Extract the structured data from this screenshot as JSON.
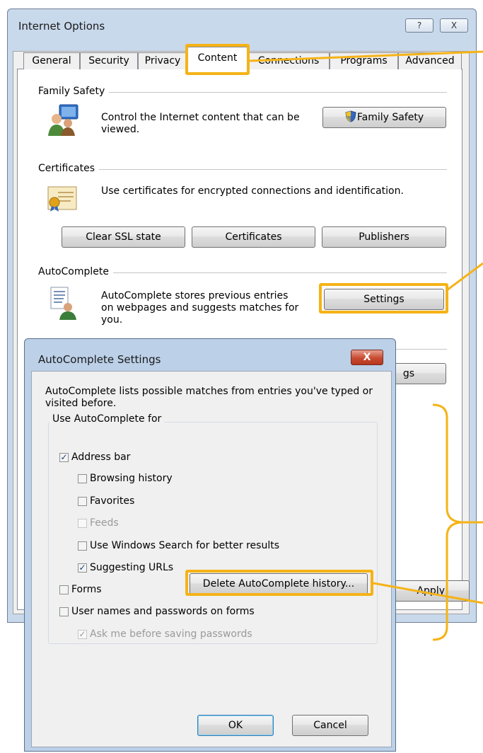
{
  "internet_options": {
    "title": "Internet Options",
    "help_button": "?",
    "close_button": "X",
    "tabs": [
      "General",
      "Security",
      "Privacy",
      "Content",
      "Connections",
      "Programs",
      "Advanced"
    ],
    "family_safety": {
      "group_label": "Family Safety",
      "description": "Control the Internet content that can be viewed.",
      "button": "Family Safety"
    },
    "certificates": {
      "group_label": "Certificates",
      "description": "Use certificates for encrypted connections and identification.",
      "buttons": [
        "Clear SSL state",
        "Certificates",
        "Publishers"
      ]
    },
    "autocomplete": {
      "group_label": "AutoComplete",
      "description": "AutoComplete stores previous entries on webpages and suggests matches for you.",
      "button": "Settings"
    },
    "hidden_button_fragment": "gs",
    "apply_button": "Apply"
  },
  "autocomplete_dialog": {
    "title": "AutoComplete Settings",
    "close_button": "X",
    "intro": "AutoComplete lists possible matches from entries you've typed or visited before.",
    "group_label": "Use AutoComplete for",
    "options": [
      {
        "label": "Address bar",
        "checked": true,
        "disabled": false
      },
      {
        "label": "Browsing history",
        "checked": false,
        "disabled": false
      },
      {
        "label": "Favorites",
        "checked": false,
        "disabled": false
      },
      {
        "label": "Feeds",
        "checked": false,
        "disabled": true
      },
      {
        "label": "Use Windows Search for better results",
        "checked": false,
        "disabled": false
      },
      {
        "label": "Suggesting URLs",
        "checked": true,
        "disabled": false
      },
      {
        "label": "Forms",
        "checked": false,
        "disabled": false
      },
      {
        "label": "User names and passwords on forms",
        "checked": false,
        "disabled": false
      },
      {
        "label": "Ask me before saving passwords",
        "checked": true,
        "disabled": true
      }
    ],
    "delete_button": "Delete AutoComplete history...",
    "ok_button": "OK",
    "cancel_button": "Cancel"
  },
  "colors": {
    "highlight": "#f5b317",
    "window_frame": "#c9d9ec",
    "dialog_frame": "#bcd0e8",
    "close_red": "#c84a31"
  }
}
